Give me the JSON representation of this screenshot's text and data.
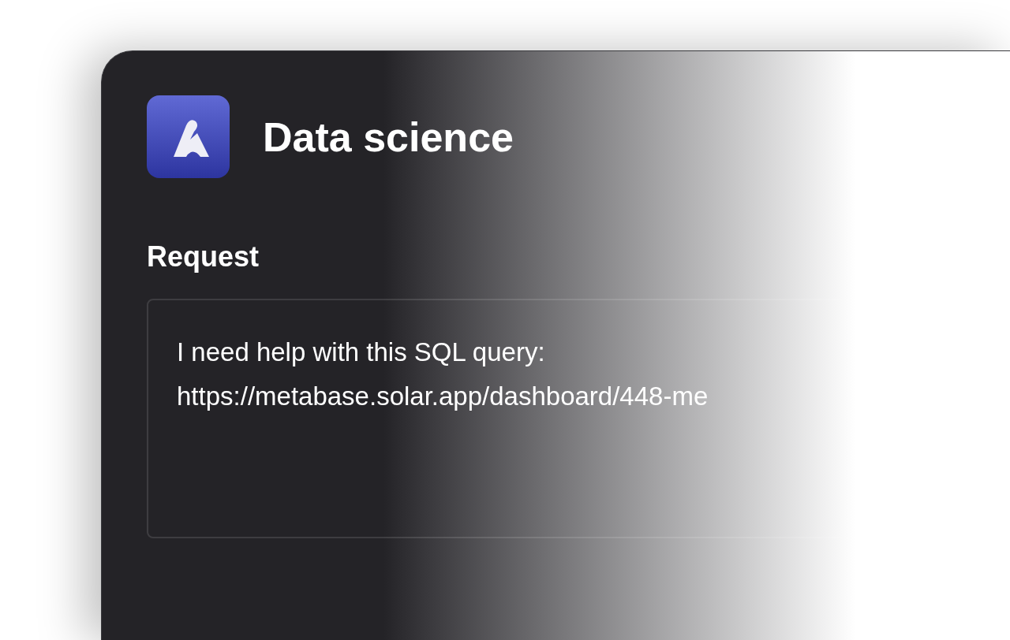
{
  "header": {
    "title": "Data science"
  },
  "request": {
    "label": "Request",
    "value": "I need help with this SQL query:\nhttps://metabase.solar.app/dashboard/448-me"
  }
}
